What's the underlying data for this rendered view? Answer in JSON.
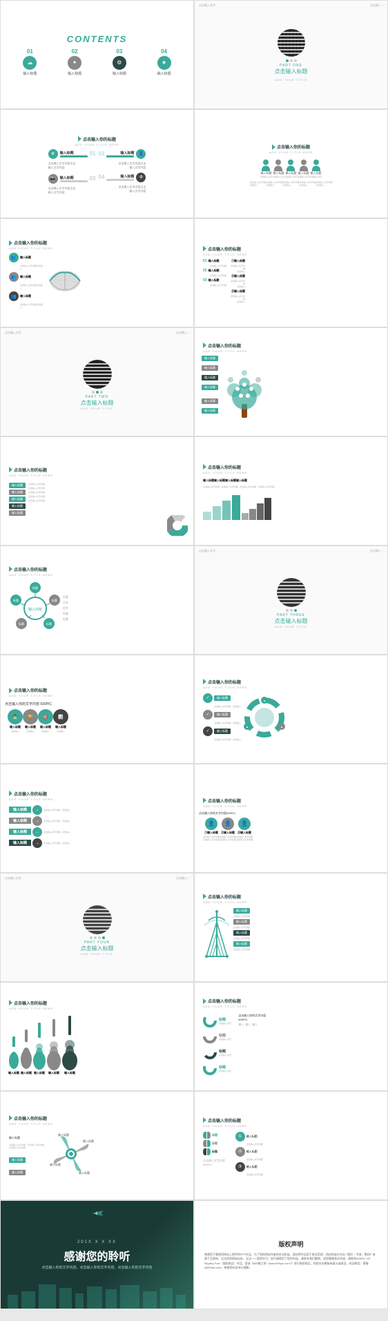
{
  "slides": [
    {
      "id": "contents",
      "type": "contents",
      "title": "CONTENTS",
      "items": [
        {
          "num": "01",
          "label": "输入标题",
          "sublabel": "输入标题"
        },
        {
          "num": "02",
          "label": "输入标题",
          "sublabel": "输入标题"
        },
        {
          "num": "03",
          "label": "输入标题",
          "sublabel": "输入标题"
        },
        {
          "num": "04",
          "label": "输入标题",
          "sublabel": "输入标题"
        }
      ]
    },
    {
      "id": "part-one",
      "type": "part",
      "part_num": "PART ONE",
      "title_zh": "点击输入标题",
      "subtitle": "ADD YOUR TITLE",
      "corner_text": "点击输入文字"
    },
    {
      "id": "slide3",
      "type": "info",
      "heading": "点击输入你的标题",
      "subheading": "ADD YOUR TITLE HERE"
    },
    {
      "id": "slide4",
      "type": "info",
      "heading": "点击输入你的标题",
      "subheading": "ADD YOUR TITLE HERE"
    },
    {
      "id": "slide5",
      "type": "info",
      "heading": "点击输入你的标题",
      "subheading": "ADD YOUR TITLE HERE"
    },
    {
      "id": "slide6",
      "type": "info",
      "heading": "点击输入你的标题",
      "subheading": "ADD YOUR TITLE HERE"
    },
    {
      "id": "part-two-label",
      "type": "part",
      "part_num": "PART TWO",
      "title_zh": "点击输入标题",
      "subtitle": "ADD YOUR TITLE",
      "corner_text": "点击输入文字"
    },
    {
      "id": "slide8",
      "type": "info",
      "heading": "点击输入你的标题",
      "subheading": "ADD YOUR TITLE HERE"
    },
    {
      "id": "slide9",
      "type": "info",
      "heading": "点击输入你的标题",
      "subheading": "ADD YOUR TITLE HERE"
    },
    {
      "id": "slide10",
      "type": "info",
      "heading": "点击输入你的标题",
      "subheading": "ADD YOUR TITLE HERE"
    },
    {
      "id": "slide11",
      "type": "info",
      "heading": "点击输入你的标题",
      "subheading": "ADD YOUR TITLE HERE"
    },
    {
      "id": "part-three-label",
      "type": "part",
      "part_num": "PART THREE",
      "title_zh": "点击输入标题",
      "subtitle": "ADD YOUR TITLE",
      "corner_text": "点击输入文字"
    },
    {
      "id": "slide13",
      "type": "info",
      "heading": "点击输入你的标题",
      "subheading": "ADD YOUR TITLE HERE"
    },
    {
      "id": "slide14",
      "type": "info",
      "heading": "点击输入你的标题",
      "subheading": "ADD YOUR TITLE HERE"
    },
    {
      "id": "slide15",
      "type": "info",
      "heading": "点击输入你的标题",
      "subheading": "ADD YOUR TITLE HERE"
    },
    {
      "id": "slide16",
      "type": "info",
      "heading": "点击输入你的标题",
      "subheading": "ADD YOUR TITLE HERE"
    },
    {
      "id": "part-four-label",
      "type": "part",
      "part_num": "PART FOUR",
      "title_zh": "点击输入标题",
      "subtitle": "ADD YOUR TITLE",
      "corner_text": "点击输入文字"
    },
    {
      "id": "slide18",
      "type": "info",
      "heading": "点击输入你的标题",
      "subheading": "ADD YOUR TITLE HERE"
    },
    {
      "id": "slide19",
      "type": "info",
      "heading": "点击输入你的标题",
      "subheading": "ADD YOUR TITLE HERE"
    },
    {
      "id": "slide20",
      "type": "info",
      "heading": "点击输入你的标题",
      "subheading": "ADD YOUR TITLE HERE"
    },
    {
      "id": "thankyou",
      "type": "thankyou",
      "date": "201X  X  X  XX",
      "title": "感谢您的聆听",
      "subtitle": "点击输入你的文字内容，点击输入你的文字内容，点击输入你的文字内容"
    },
    {
      "id": "copyright",
      "type": "copyright",
      "title": "版权声明",
      "text": "感谢您下载使用网站上提供的PPT作品，为了您和网站作者的合法权益，请勿将作品用于商业用途；网站的部分作品《图片／字体／素材》来源于互联网，无法找到原始出处，无法一一获得许可，如不慎侵犯了您的利益，请联系我们删除。如您需要商业用途，请联系699PIC VIP Royalty-Free（版权购买）作品，登录《699美工网（www.699pic.com）》进行版权购买，如您对本模板有疑义或意见，欢迎致信：客服@699pic.com，感谢您的支持与理解。"
    }
  ],
  "labels": {
    "input_title": "输入标题",
    "input_text": "输入文字",
    "click_input": "点击输入",
    "add_your_title": "ADD YOUR TITLE HERE",
    "small_text": "点击输入文字内容，点击输入文字内容",
    "699pic": "699PIC",
    "num01": "01输入标题",
    "num02": "02输入标题",
    "num03": "03输入标题",
    "part_one": "PART ONE",
    "part_two": "PART TWO",
    "part_three": "PART THREE",
    "part_four": "PART FOUR"
  },
  "colors": {
    "teal": "#3aaa9a",
    "dark": "#2d4a47",
    "gray": "#888888",
    "light_gray": "#cccccc",
    "text": "#555555"
  }
}
